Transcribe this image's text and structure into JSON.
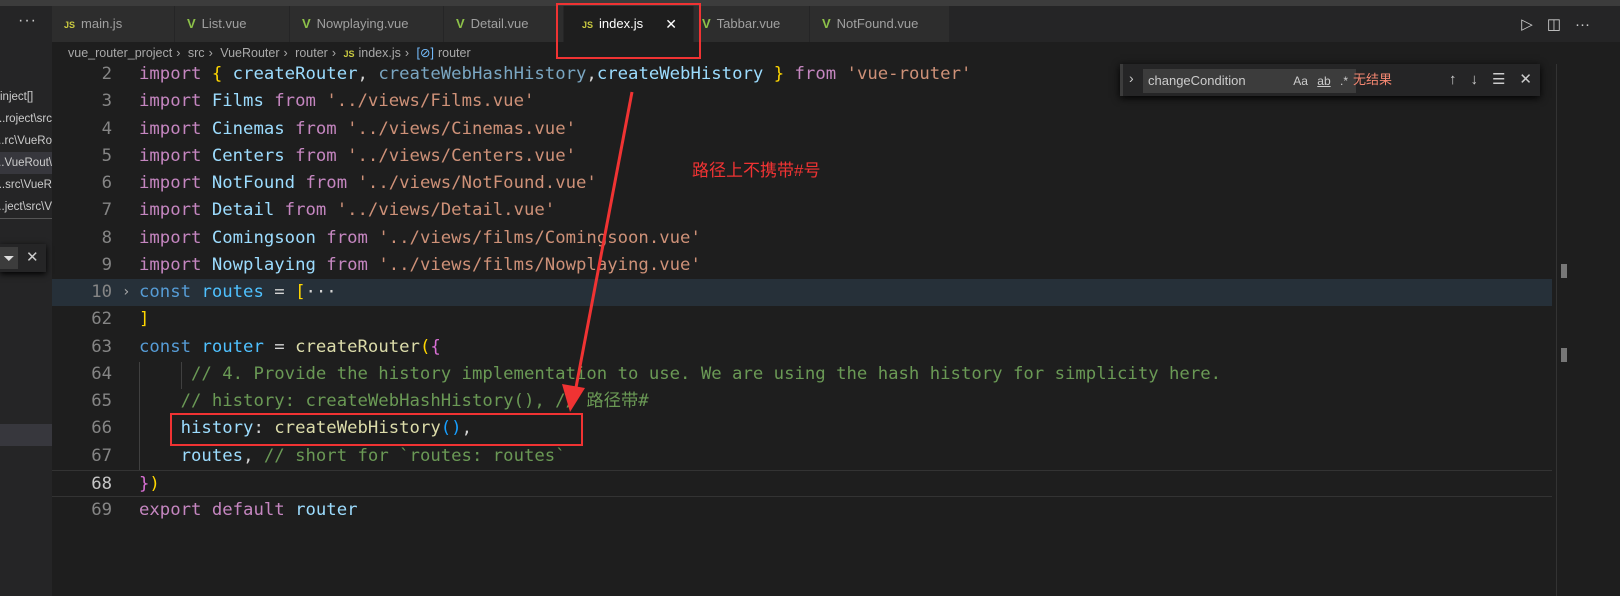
{
  "sidebar": {
    "more": "···",
    "items": [
      "[]inject",
      "roject\\src...",
      "rc\\VueRo...",
      "\\VueRout...",
      "src\\VueR...",
      "ject\\src\\V..."
    ],
    "filter_icon": "filter-icon",
    "close": "✕"
  },
  "tabs": [
    {
      "label": "main.js",
      "type": "js"
    },
    {
      "label": "List.vue",
      "type": "vue"
    },
    {
      "label": "Nowplaying.vue",
      "type": "vue"
    },
    {
      "label": "Detail.vue",
      "type": "vue"
    },
    {
      "label": "index.js",
      "type": "js",
      "active": true
    },
    {
      "label": "Tabbar.vue",
      "type": "vue"
    },
    {
      "label": "NotFound.vue",
      "type": "vue"
    }
  ],
  "tab_close": "✕",
  "editor_actions": {
    "run": "▷",
    "split": "◫",
    "more": "···"
  },
  "breadcrumb": [
    "vue_router_project",
    "src",
    "VueRouter",
    "router",
    "index.js",
    "router"
  ],
  "find": {
    "value": "changeCondition",
    "case": "Aa",
    "word": "ab",
    "regex": ".*",
    "result": "无结果"
  },
  "annotation": "路径上不携带#号",
  "colors": {
    "accent_red": "#f03333",
    "background": "#1e1e1e"
  },
  "code": [
    {
      "n": "2",
      "t": [
        [
          "kw",
          "import "
        ],
        [
          "b1",
          "{ "
        ],
        [
          "var",
          "createRouter"
        ],
        [
          "p",
          ", "
        ],
        [
          "dim",
          "createWebHashHistory"
        ],
        [
          "p",
          ","
        ],
        [
          "var",
          "createWebHistory"
        ],
        [
          "b1",
          " }"
        ],
        [
          "kw",
          " from "
        ],
        [
          "str",
          "'vue-router'"
        ]
      ]
    },
    {
      "n": "3",
      "t": [
        [
          "kw",
          "import "
        ],
        [
          "var",
          "Films"
        ],
        [
          "kw",
          " from "
        ],
        [
          "str",
          "'../views/Films.vue'"
        ]
      ]
    },
    {
      "n": "4",
      "t": [
        [
          "kw",
          "import "
        ],
        [
          "var",
          "Cinemas"
        ],
        [
          "kw",
          " from "
        ],
        [
          "str",
          "'../views/Cinemas.vue'"
        ]
      ]
    },
    {
      "n": "5",
      "t": [
        [
          "kw",
          "import "
        ],
        [
          "var",
          "Centers"
        ],
        [
          "kw",
          " from "
        ],
        [
          "str",
          "'../views/Centers.vue'"
        ]
      ]
    },
    {
      "n": "6",
      "t": [
        [
          "kw",
          "import "
        ],
        [
          "var",
          "NotFound"
        ],
        [
          "kw",
          " from "
        ],
        [
          "str",
          "'../views/NotFound.vue'"
        ]
      ]
    },
    {
      "n": "7",
      "t": [
        [
          "kw",
          "import "
        ],
        [
          "var",
          "Detail"
        ],
        [
          "kw",
          " from "
        ],
        [
          "str",
          "'../views/Detail.vue'"
        ]
      ]
    },
    {
      "n": "8",
      "t": [
        [
          "kw",
          "import "
        ],
        [
          "var",
          "Comingsoon"
        ],
        [
          "kw",
          " from "
        ],
        [
          "str",
          "'../views/films/Comingsoon.vue'"
        ]
      ]
    },
    {
      "n": "9",
      "t": [
        [
          "kw",
          "import "
        ],
        [
          "var",
          "Nowplaying"
        ],
        [
          "kw",
          " from "
        ],
        [
          "str",
          "'../views/films/Nowplaying.vue'"
        ]
      ]
    },
    {
      "n": "10",
      "fold": true,
      "t": [
        [
          "kb",
          "const "
        ],
        [
          "cv",
          "routes"
        ],
        [
          "p",
          " = "
        ],
        [
          "b1",
          "["
        ],
        [
          "p",
          "···"
        ]
      ]
    },
    {
      "n": "62",
      "t": [
        [
          "b1",
          "]"
        ]
      ]
    },
    {
      "n": "63",
      "t": [
        [
          "kb",
          "const "
        ],
        [
          "cv",
          "router"
        ],
        [
          "p",
          " = "
        ],
        [
          "fn",
          "createRouter"
        ],
        [
          "b1",
          "("
        ],
        [
          "b2",
          "{"
        ]
      ]
    },
    {
      "n": "64",
      "t": [
        [
          "p",
          "     "
        ],
        [
          "cm",
          "// 4. Provide the history implementation to use. We are using the hash history for simplicity here."
        ]
      ]
    },
    {
      "n": "65",
      "t": [
        [
          "p",
          "    "
        ],
        [
          "cm",
          "// history: createWebHashHistory(), // 路径带#"
        ]
      ]
    },
    {
      "n": "66",
      "t": [
        [
          "p",
          "    "
        ],
        [
          "var",
          "history"
        ],
        [
          "p",
          ": "
        ],
        [
          "fn",
          "createWebHistory"
        ],
        [
          "b3",
          "()"
        ],
        [
          "p",
          ","
        ]
      ]
    },
    {
      "n": "67",
      "t": [
        [
          "p",
          "    "
        ],
        [
          "var",
          "routes"
        ],
        [
          "p",
          ", "
        ],
        [
          "cm",
          "// short for `routes: routes`"
        ]
      ]
    },
    {
      "n": "68",
      "t": [
        [
          "b2",
          "}"
        ],
        [
          "b1",
          ")"
        ]
      ]
    },
    {
      "n": "69",
      "t": [
        [
          "kw",
          "export default "
        ],
        [
          "var",
          "router"
        ]
      ]
    }
  ]
}
